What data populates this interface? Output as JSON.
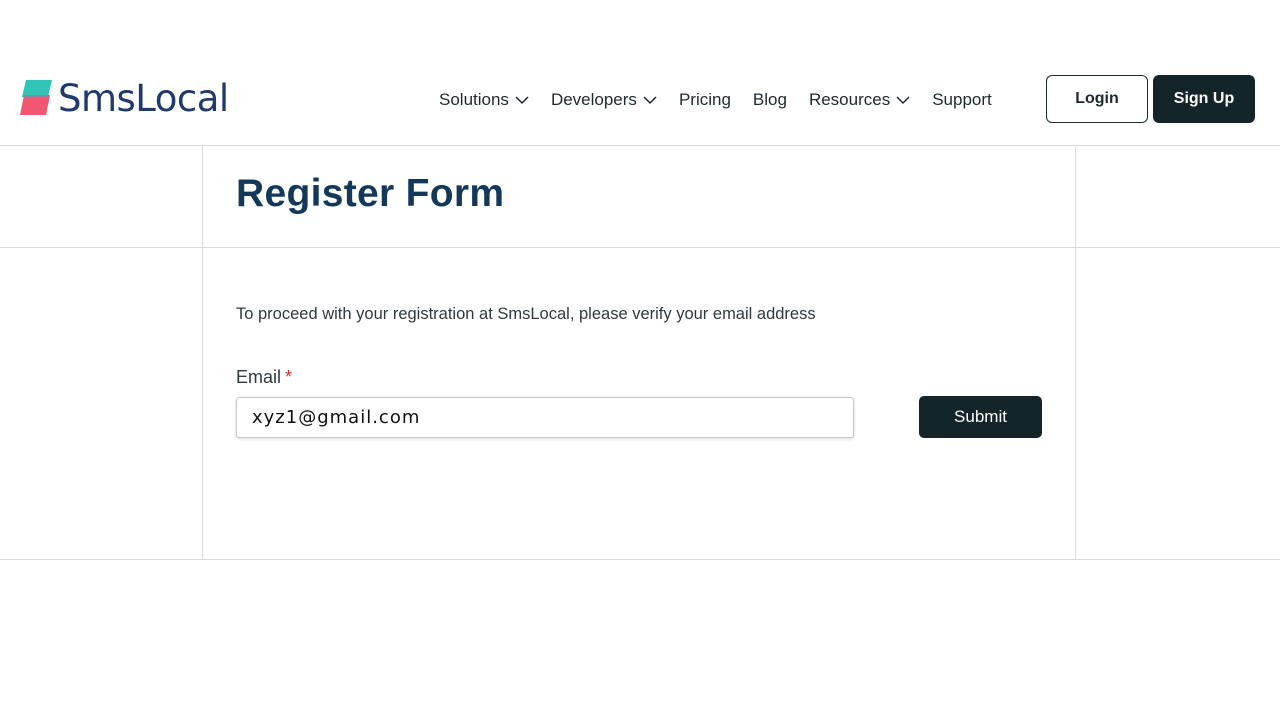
{
  "brand": {
    "name": "SmsLocal",
    "colors": {
      "logo_teal": "#2ec4b6",
      "logo_red": "#ef4f6a",
      "logo_text": "#1f3a6e"
    }
  },
  "nav": {
    "items": [
      {
        "label": "Solutions",
        "has_dropdown": true,
        "icon": "chevron-down-icon"
      },
      {
        "label": "Developers",
        "has_dropdown": true,
        "icon": "chevron-down-icon"
      },
      {
        "label": "Pricing",
        "has_dropdown": false
      },
      {
        "label": "Blog",
        "has_dropdown": false
      },
      {
        "label": "Resources",
        "has_dropdown": true,
        "icon": "chevron-down-icon"
      },
      {
        "label": "Support",
        "has_dropdown": false
      }
    ],
    "login_label": "Login",
    "signup_label": "Sign Up"
  },
  "form": {
    "title": "Register Form",
    "instruction": "To proceed with your registration at SmsLocal, please verify your email address",
    "email_label": "Email",
    "required_marker": "*",
    "email_value": "xyz1@gmail.com",
    "submit_label": "Submit"
  },
  "colors": {
    "dark_button": "#14252a",
    "title": "#14385a",
    "required": "#d32f2f",
    "divider": "#dcdcdc"
  }
}
